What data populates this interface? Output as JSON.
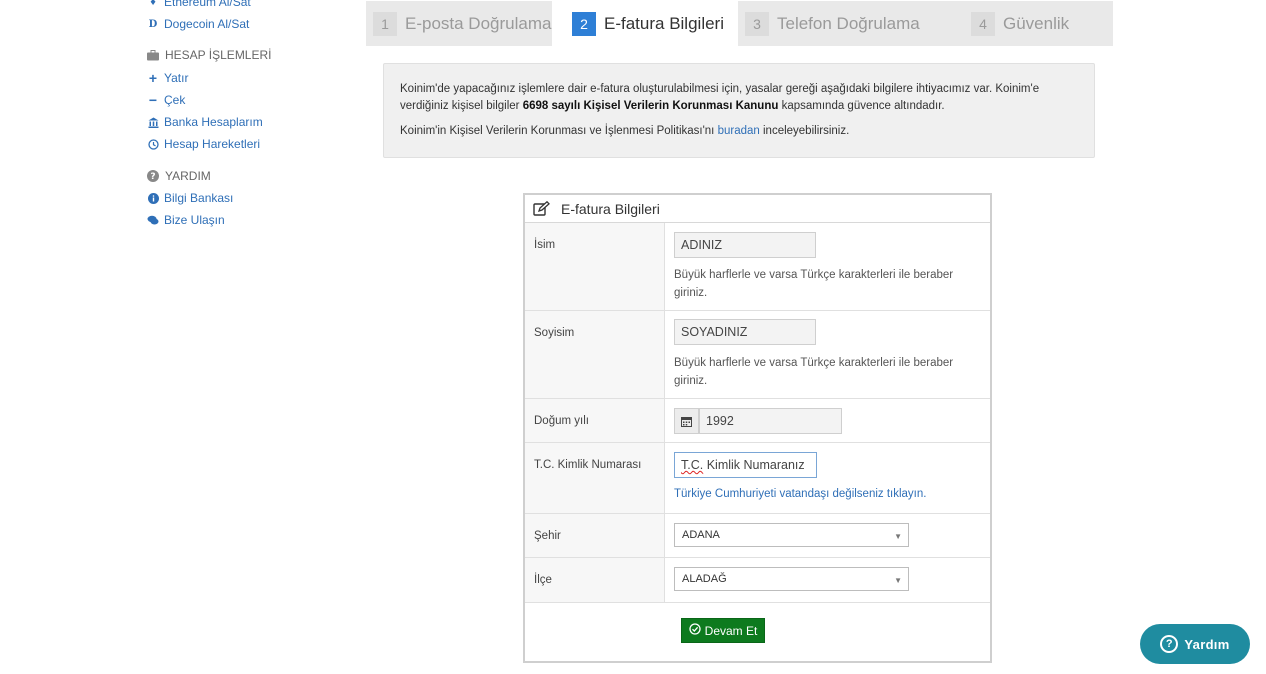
{
  "sidebar": {
    "top_items": [
      {
        "label": "Ethereum Al/Sat",
        "icon": "ethereum-icon"
      },
      {
        "label": "Dogecoin Al/Sat",
        "icon": "dogecoin-icon"
      }
    ],
    "account_section": {
      "title": "HESAP İŞLEMLERİ",
      "icon": "briefcase-icon",
      "items": [
        {
          "label": "Yatır",
          "icon": "plus-icon"
        },
        {
          "label": "Çek",
          "icon": "minus-icon"
        },
        {
          "label": "Banka Hesaplarım",
          "icon": "bank-icon"
        },
        {
          "label": "Hesap Hareketleri",
          "icon": "history-icon"
        }
      ]
    },
    "help_section": {
      "title": "YARDIM",
      "icon": "question-icon",
      "items": [
        {
          "label": "Bilgi Bankası",
          "icon": "info-icon"
        },
        {
          "label": "Bize Ulaşın",
          "icon": "chat-icon"
        }
      ]
    }
  },
  "steps": [
    {
      "num": "1",
      "label": "E-posta Doğrulama",
      "active": false
    },
    {
      "num": "2",
      "label": "E-fatura Bilgileri",
      "active": true
    },
    {
      "num": "3",
      "label": "Telefon Doğrulama",
      "active": false
    },
    {
      "num": "4",
      "label": "Güvenlik",
      "active": false
    }
  ],
  "info": {
    "line1_a": "Koinim'de yapacağınız işlemlere dair e-fatura oluşturulabilmesi için, yasalar gereği aşağıdaki bilgilere ihtiyacımız var. Koinim'e verdiğiniz kişisel bilgiler ",
    "line1_bold": "6698 sayılı Kişisel Verilerin Korunması Kanunu",
    "line1_b": " kapsamında güvence altındadır.",
    "line2_a": "Koinim'in Kişisel Verilerin Korunması ve İşlenmesi Politikası'nı ",
    "line2_link": "buradan",
    "line2_b": " inceleyebilirsiniz."
  },
  "form": {
    "title": "E-fatura Bilgileri",
    "name_label": "İsim",
    "name_value": "ADINIZ",
    "name_hint": "Büyük harflerle ve varsa Türkçe karakterleri ile beraber giriniz.",
    "surname_label": "Soyisim",
    "surname_value": "SOYADINIZ",
    "surname_hint": "Büyük harflerle ve varsa Türkçe karakterleri ile beraber giriniz.",
    "birth_label": "Doğum yılı",
    "birth_value": "1992",
    "tc_label": "T.C. Kimlik Numarası",
    "tc_value_abbr": "T.C.",
    "tc_value_rest": " Kimlik Numaranız",
    "tc_link": "Türkiye Cumhuriyeti vatandaşı değilseniz tıklayın.",
    "city_label": "Şehir",
    "city_value": "ADANA",
    "district_label": "İlçe",
    "district_value": "ALADAĞ",
    "submit_label": "Devam Et"
  },
  "help_button": {
    "label": "Yardım"
  },
  "colors": {
    "link": "#2f6fb7",
    "active_step": "#2e7fd6",
    "submit": "#0d7a1e",
    "help": "#1f8ca0"
  }
}
